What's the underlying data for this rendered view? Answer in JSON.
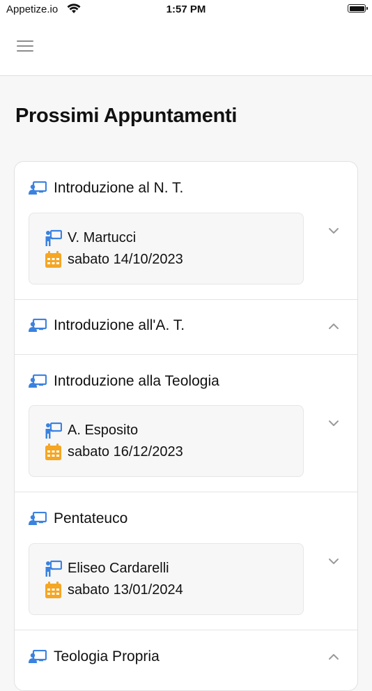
{
  "status_bar": {
    "carrier": "Appetize.io",
    "time": "1:57 PM"
  },
  "header": {
    "menu_icon": "hamburger-menu-icon"
  },
  "page_title": "Prossimi Appuntamenti",
  "colors": {
    "icon_blue": "#3b82e0",
    "calendar_orange": "#f5a623",
    "chevron_gray": "#9a9a9a"
  },
  "courses": [
    {
      "title": "Introduzione al N. T.",
      "expanded": true,
      "teacher": "V. Martucci",
      "date": "sabato 14/10/2023"
    },
    {
      "title": "Introduzione all'A. T.",
      "expanded": false
    },
    {
      "title": "Introduzione alla Teologia",
      "expanded": true,
      "teacher": "A. Esposito",
      "date": "sabato 16/12/2023"
    },
    {
      "title": "Pentateuco",
      "expanded": true,
      "teacher": "Eliseo Cardarelli",
      "date": "sabato 13/01/2024"
    },
    {
      "title": "Teologia Propria",
      "expanded": false
    }
  ]
}
